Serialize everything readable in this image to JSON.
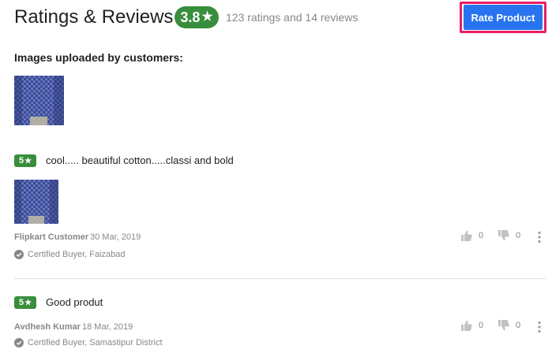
{
  "header": {
    "title": "Ratings & Reviews",
    "average_rating": "3.8",
    "summary": "123 ratings and 14 reviews",
    "rate_button_label": "Rate Product"
  },
  "customer_images": {
    "heading": "Images uploaded by customers:"
  },
  "reviews": [
    {
      "rating": "5",
      "title": "cool..... beautiful cotton.....classi and bold",
      "author": "Flipkart Customer",
      "date": "30 Mar, 2019",
      "certified": "Certified Buyer, Faizabad",
      "likes": "0",
      "dislikes": "0",
      "has_image": true
    },
    {
      "rating": "5",
      "title": "Good produt",
      "author": "Avdhesh Kumar",
      "date": "18 Mar, 2019",
      "certified": "Certified Buyer, Samastipur District",
      "likes": "0",
      "dislikes": "0",
      "has_image": false
    }
  ],
  "colors": {
    "rating_green": "#388e3c",
    "button_blue": "#2874f0",
    "highlight_pink": "#e91e63",
    "muted_text": "#878787"
  },
  "icons": {
    "rating_star": "★",
    "like": "thumb-up-icon",
    "dislike": "thumb-down-icon",
    "more": "more-vertical-icon",
    "certified": "check-circle-icon"
  }
}
